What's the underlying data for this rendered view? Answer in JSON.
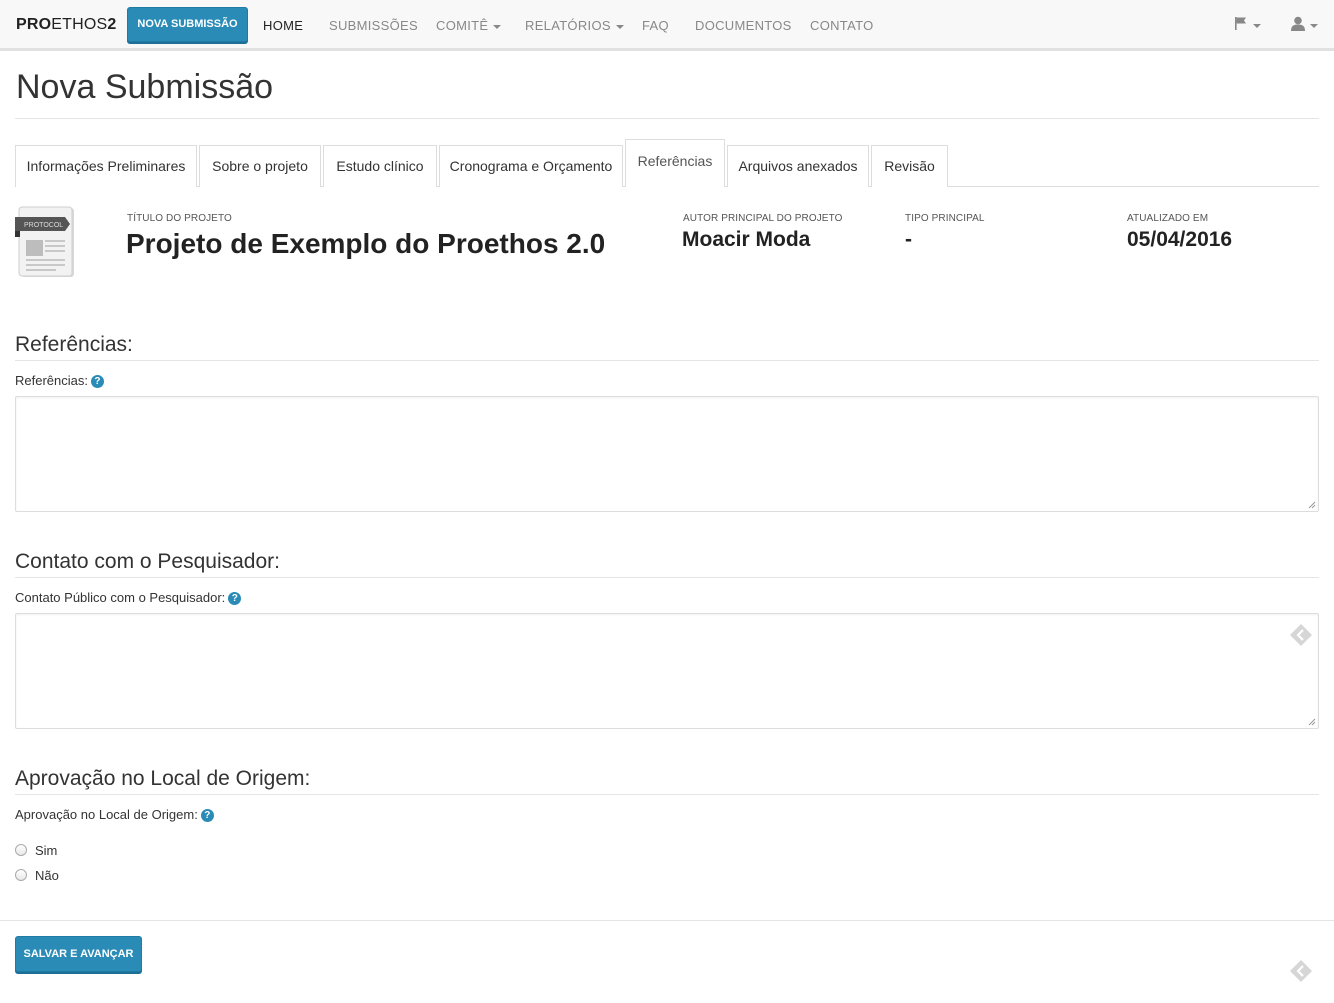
{
  "navbar": {
    "brand_bold": "PRO",
    "brand_light": "ETHOS",
    "brand_num": "2",
    "new_submission": "NOVA SUBMISSÃO",
    "items": [
      {
        "label": "HOME",
        "active": true,
        "dropdown": false
      },
      {
        "label": "SUBMISSÕES",
        "active": false,
        "dropdown": false
      },
      {
        "label": "COMITÊ",
        "active": false,
        "dropdown": true
      },
      {
        "label": "RELATÓRIOS",
        "active": false,
        "dropdown": true
      },
      {
        "label": "FAQ",
        "active": false,
        "dropdown": false
      },
      {
        "label": "DOCUMENTOS",
        "active": false,
        "dropdown": false
      },
      {
        "label": "CONTATO",
        "active": false,
        "dropdown": false
      }
    ],
    "icons": [
      "flag-icon",
      "user-icon"
    ]
  },
  "page": {
    "title": "Nova Submissão"
  },
  "tabs": [
    {
      "label": "Informações Preliminares",
      "active": false
    },
    {
      "label": "Sobre o projeto",
      "active": false
    },
    {
      "label": "Estudo clínico",
      "active": false
    },
    {
      "label": "Cronograma e Orçamento",
      "active": false
    },
    {
      "label": "Referências",
      "active": true
    },
    {
      "label": "Arquivos anexados",
      "active": false
    },
    {
      "label": "Revisão",
      "active": false
    }
  ],
  "project": {
    "icon_text": "PROTOCOL",
    "title_label": "TÍTULO DO PROJETO",
    "title": "Projeto de Exemplo do Proethos 2.0",
    "author_label": "AUTOR PRINCIPAL DO PROJETO",
    "author": "Moacir Moda",
    "type_label": "TIPO PRINCIPAL",
    "type": "-",
    "updated_label": "ATUALIZADO EM",
    "updated": "05/04/2016"
  },
  "sections": {
    "references": {
      "title": "Referências:",
      "field_label": "Referências:",
      "value": ""
    },
    "contact": {
      "title": "Contato com o Pesquisador:",
      "field_label": "Contato Público com o Pesquisador:",
      "value": ""
    },
    "approval": {
      "title": "Aprovação no Local de Origem:",
      "field_label": "Aprovação no Local de Origem:",
      "options": [
        "Sim",
        "Não"
      ],
      "selected": null
    }
  },
  "help_glyph": "?",
  "actions": {
    "save": "SALVAR E AVANÇAR"
  },
  "colors": {
    "primary": "#2a8bb7",
    "navbar_bg": "#f8f8f8",
    "text": "#333333"
  }
}
